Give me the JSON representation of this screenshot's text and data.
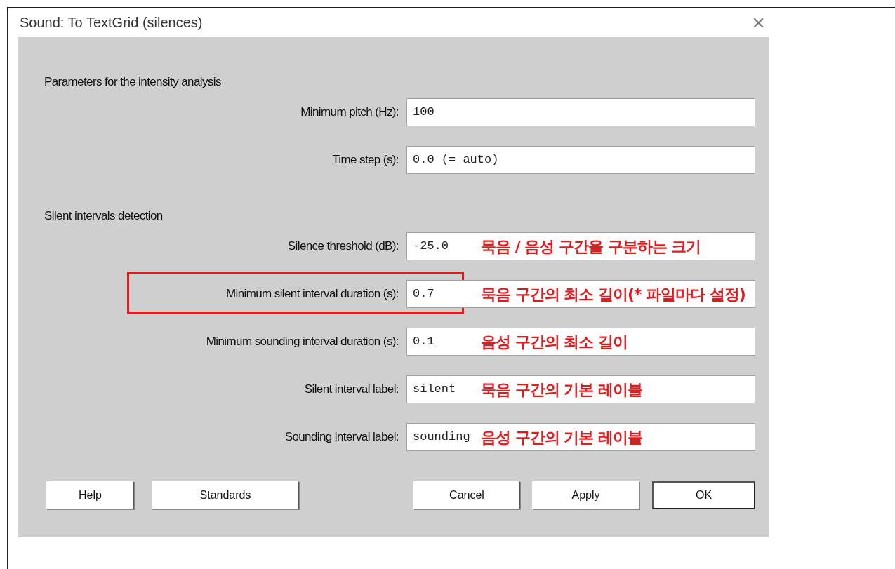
{
  "window": {
    "title": "Sound: To TextGrid (silences)",
    "close": "×"
  },
  "sections": [
    {
      "heading": "Parameters for the intensity analysis",
      "fields": [
        {
          "label": "Minimum pitch (Hz):",
          "value": "100",
          "highlighted": false
        },
        {
          "label": "Time step (s):",
          "value": "0.0 (= auto)",
          "highlighted": false
        }
      ]
    },
    {
      "heading": "Silent intervals detection",
      "fields": [
        {
          "label": "Silence threshold (dB):",
          "value": "-25.0",
          "annotation": "묵음 / 음성 구간을 구분하는 크기",
          "highlighted": false
        },
        {
          "label": "Minimum silent interval duration (s):",
          "value": "0.7",
          "annotation": "묵음 구간의 최소 길이(* 파일마다 설정)",
          "highlighted": true
        },
        {
          "label": "Minimum sounding interval duration (s):",
          "value": "0.1",
          "annotation": "음성 구간의 최소 길이",
          "highlighted": false
        },
        {
          "label": "Silent interval label:",
          "value": "silent",
          "annotation": "묵음 구간의 기본 레이블",
          "highlighted": false
        },
        {
          "label": "Sounding interval label:",
          "value": "sounding",
          "annotation": "음성 구간의 기본 레이블",
          "highlighted": false
        }
      ]
    }
  ],
  "buttons": [
    {
      "label": "Help",
      "default": false
    },
    {
      "label": "Standards",
      "default": false
    },
    {
      "label": "Cancel",
      "default": false
    },
    {
      "label": "Apply",
      "default": false
    },
    {
      "label": "OK",
      "default": true
    }
  ]
}
